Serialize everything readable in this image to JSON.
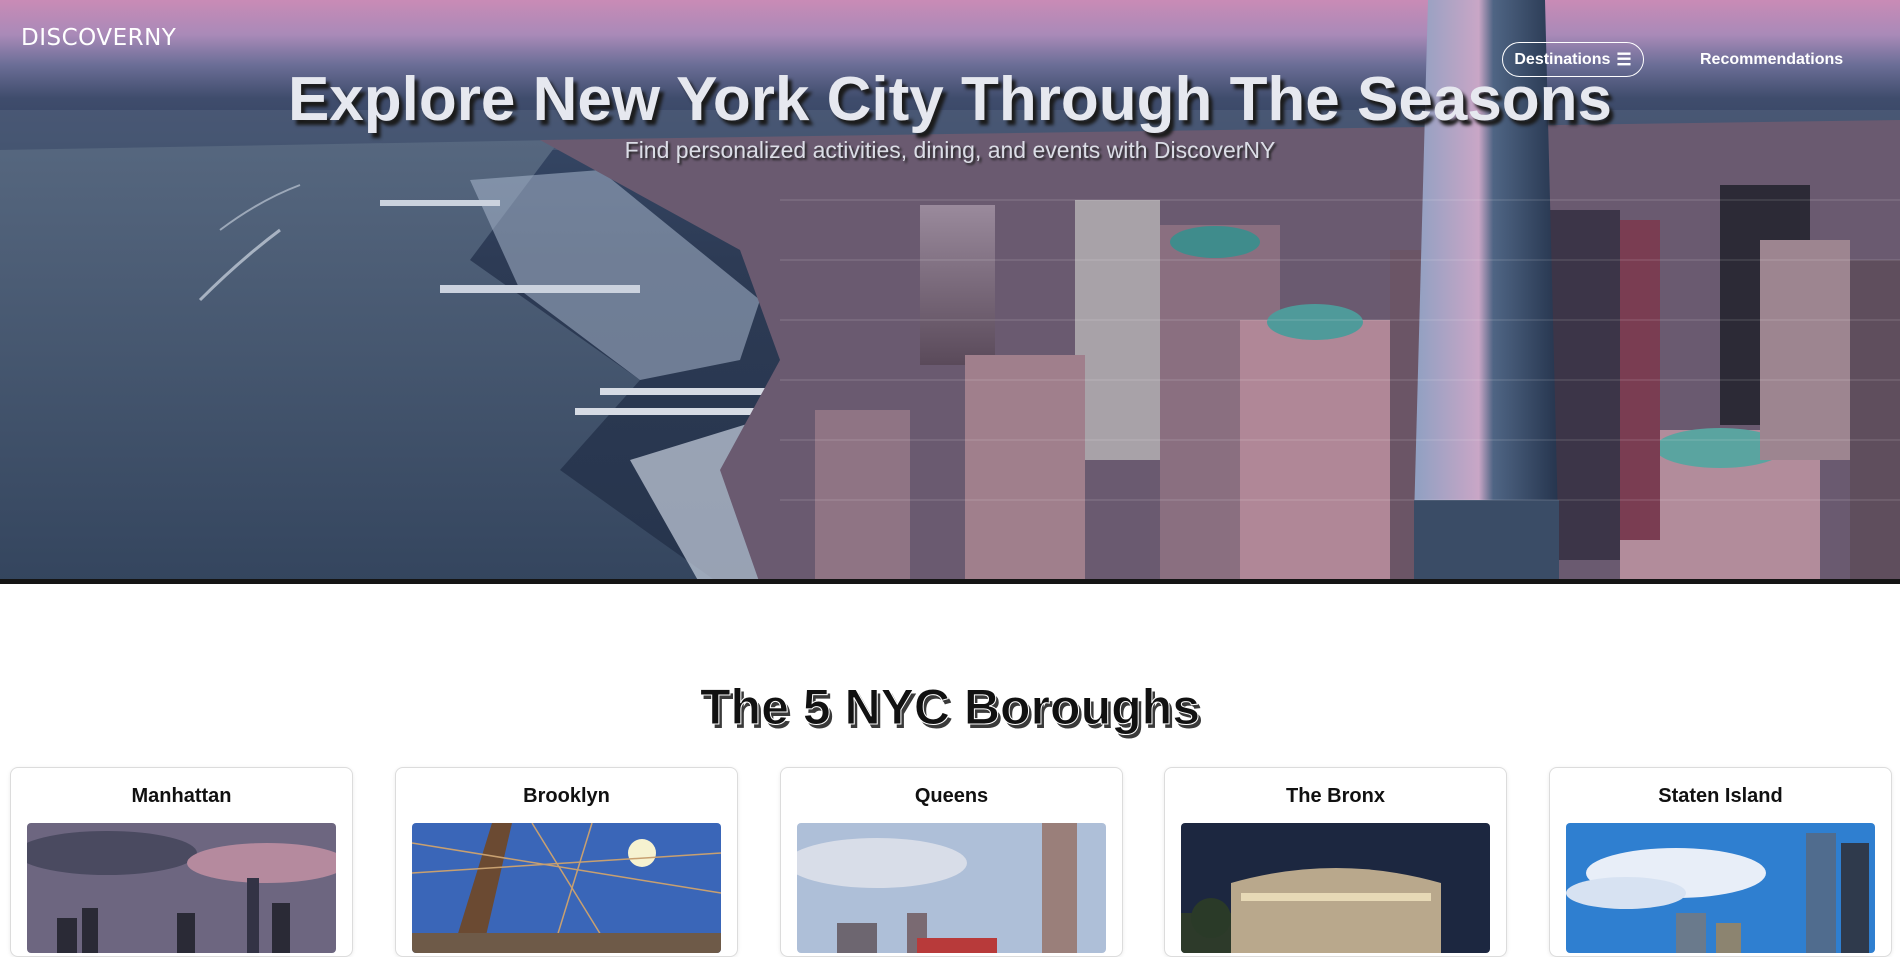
{
  "header": {
    "logo": "DISCOVERNY",
    "nav": {
      "destinations_label": "Destinations",
      "destinations_icon": "menu-icon",
      "recommendations_label": "Recommendations"
    }
  },
  "hero": {
    "title": "Explore New York City Through The Seasons",
    "subtitle": "Find personalized activities, dining, and events with DiscoverNY"
  },
  "boroughs": {
    "title": "The 5 NYC Boroughs",
    "items": [
      {
        "name": "Manhattan"
      },
      {
        "name": "Brooklyn"
      },
      {
        "name": "Queens"
      },
      {
        "name": "The Bronx"
      },
      {
        "name": "Staten Island"
      }
    ]
  },
  "colors": {
    "accent_text": "#ffffff",
    "hero_sky_pink": "#c98bb6",
    "hero_water": "#3b4d68"
  }
}
